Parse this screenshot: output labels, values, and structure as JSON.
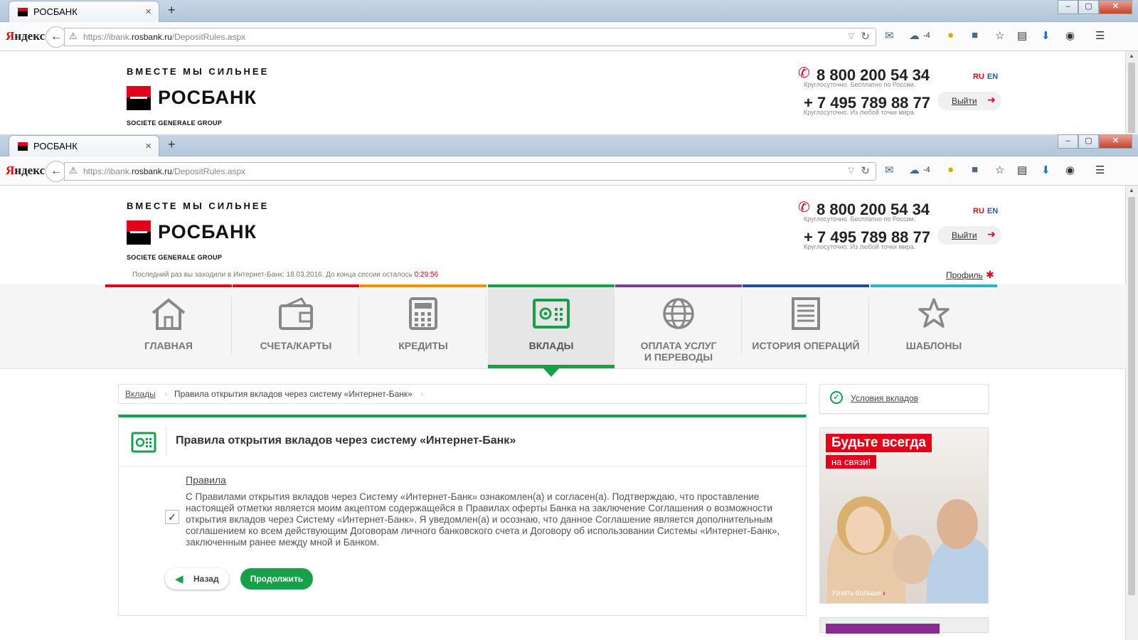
{
  "browser": {
    "tab_title": "РОСБАНК",
    "tab_close": "×",
    "new_tab": "+",
    "yandex_y": "Я",
    "yandex_rest": "ндекс",
    "url_prefix": "https://ibank.",
    "url_domain": "rosbank.ru",
    "url_path": "/DepositRules.aspx",
    "weather": "-4",
    "win_min": "–",
    "win_max": "▢",
    "win_close": "✕"
  },
  "header": {
    "slogan": "ВМЕСТЕ МЫ СИЛЬНЕЕ",
    "logo": "РОСБАНК",
    "group": "SOCIETE GENERALE GROUP",
    "phone1": "8 800 200 54 34",
    "phone1_note": "Круглосуточно. Бесплатно по России.",
    "phone2": "+ 7 495 789 88 77",
    "phone2_note": "Круглосуточно. Из любой точки мира.",
    "lang_ru": "RU",
    "lang_en": "EN",
    "logout": "Выйти"
  },
  "session": {
    "last_visit": "Последний раз вы заходили в Интернет-Банк: 18.03.2016.   До конца сессии осталось ",
    "time_left": "0:29:56",
    "profile": "Профиль"
  },
  "menu": [
    {
      "label": "ГЛАВНАЯ",
      "color": "#e3001b",
      "icon": "home-icon"
    },
    {
      "label": "СЧЕТА/КАРТЫ",
      "color": "#e3001b",
      "icon": "wallet-icon"
    },
    {
      "label": "КРЕДИТЫ",
      "color": "#f39200",
      "icon": "calculator-icon"
    },
    {
      "label": "ВКЛАДЫ",
      "color": "#16a04a",
      "icon": "safe-icon",
      "active": true
    },
    {
      "label": "ОПЛАТА УСЛУГ\nИ ПЕРЕВОДЫ",
      "color": "#7b3f98",
      "icon": "globe-icon"
    },
    {
      "label": "ИСТОРИЯ ОПЕРАЦИЙ",
      "color": "#1c4f9c",
      "icon": "document-icon"
    },
    {
      "label": "ШАБЛОНЫ",
      "color": "#2ab3c8",
      "icon": "star-icon"
    }
  ],
  "breadcrumb": {
    "root": "Вклады",
    "current": "Правила открытия вкладов через систему «Интернет-Банк»"
  },
  "panel": {
    "title": "Правила открытия вкладов через систему «Интернет-Банк»",
    "rules_link": "Правила",
    "agreement": "С Правилами открытия вкладов через Систему «Интернет-Банк» ознакомлен(а) и согласен(а). Подтверждаю, что проставление настоящей отметки является моим акцептом содержащейся в Правилах оферты Банка на заключение Соглашения о возможности открытия вкладов через Систему «Интернет-Банк». Я уведомлен(а) и осознаю, что данное Соглашение является дополнительным соглашением ко всем действующим Договорам личного банковского счета и Договору об использовании Системы «Интернет-Банк», заключенным ранее между мной и Банком.",
    "checked": true,
    "back": "Назад",
    "continue": "Продолжить"
  },
  "sidebar": {
    "conditions": "Условия вкладов",
    "promo_title": "Будьте всегда",
    "promo_sub": "на связи!",
    "promo_more": "Узнать больше"
  },
  "colors": {
    "brand": "#e3001b",
    "accent": "#16a04a"
  }
}
